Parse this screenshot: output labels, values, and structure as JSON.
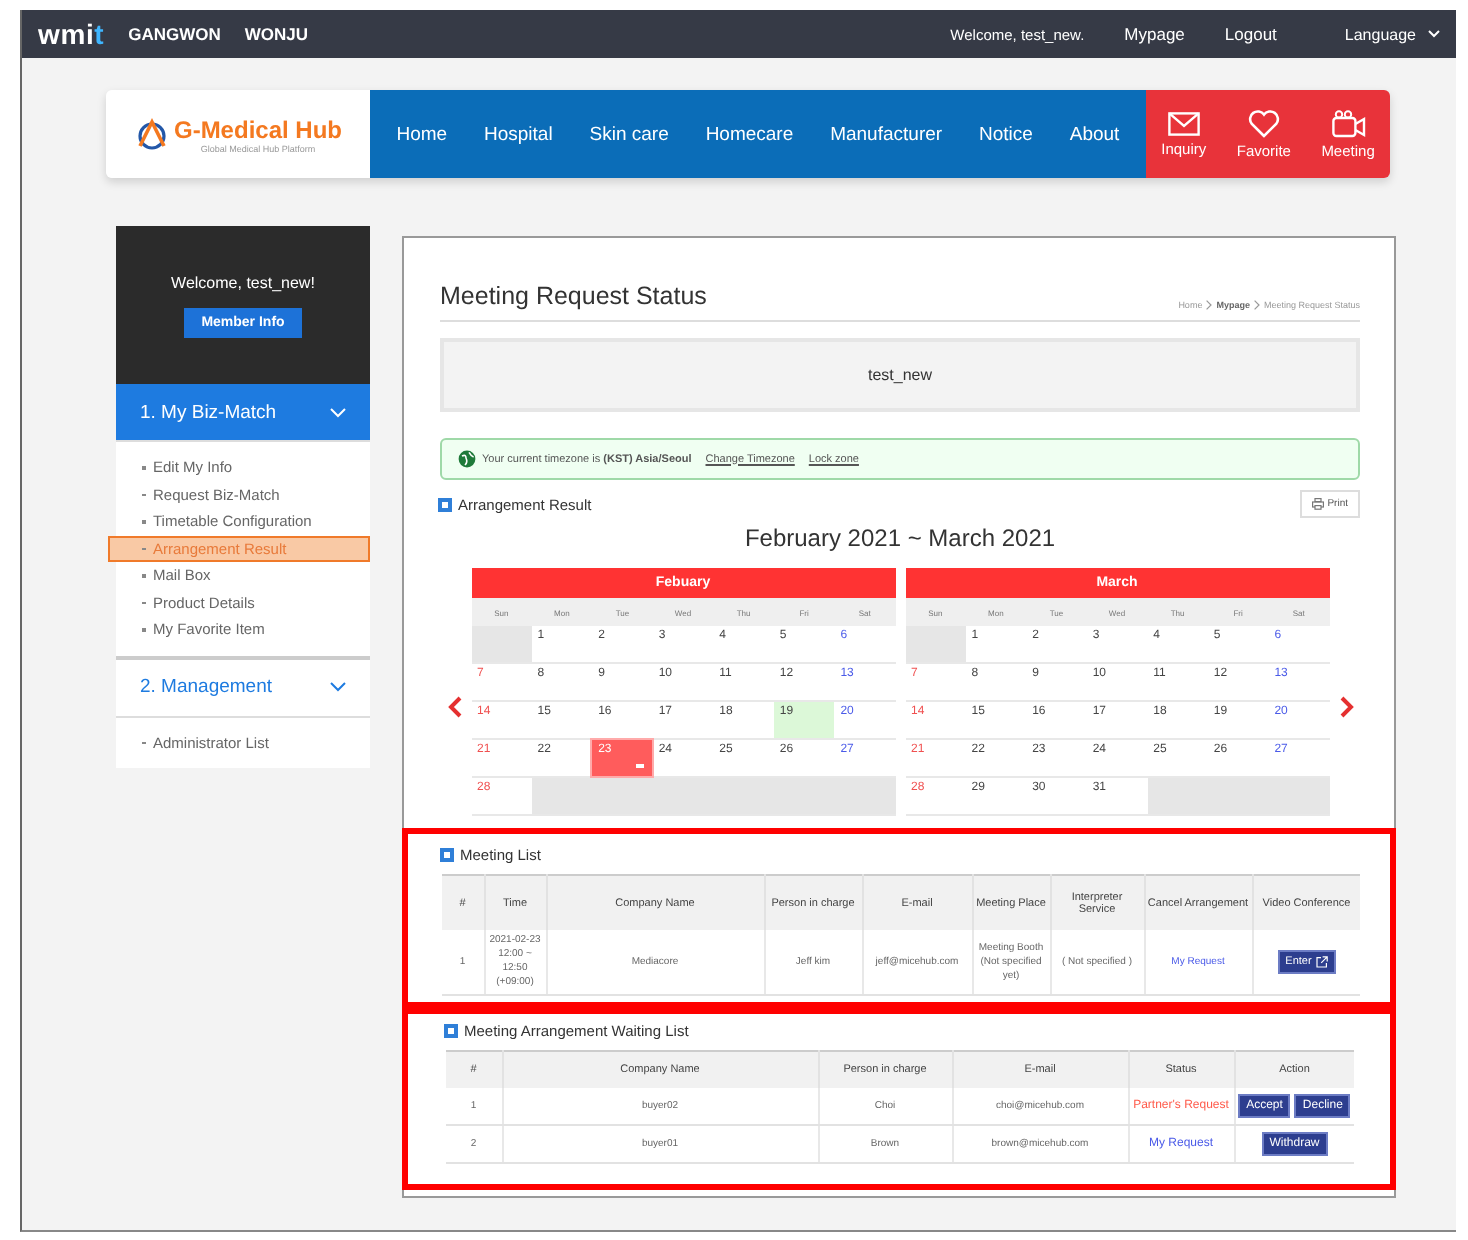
{
  "top_bar": {
    "logo": {
      "text": "wmi",
      "accent": "t"
    },
    "regions": [
      "GANGWON",
      "WONJU"
    ],
    "welcome": "Welcome, test_new.",
    "links": [
      "Mypage",
      "Logout"
    ],
    "language": "Language"
  },
  "header": {
    "brand": "G-Medical Hub",
    "tagline": "Global Medical Hub Platform",
    "nav": [
      "Home",
      "Hospital",
      "Skin care",
      "Homecare",
      "Manufacturer",
      "Notice",
      "About"
    ],
    "quick_links": [
      {
        "label": "Inquiry",
        "kind": "mail"
      },
      {
        "label": "Favorite",
        "kind": "heart"
      },
      {
        "label": "Meeting",
        "kind": "camera"
      }
    ]
  },
  "sidebar": {
    "welcome": "Welcome, test_new!",
    "member_button": "Member Info",
    "sections": [
      {
        "title": "1. My Biz-Match",
        "selected": true,
        "items": [
          {
            "label": "Edit My Info",
            "selected": false
          },
          {
            "label": "Request Biz-Match",
            "selected": false
          },
          {
            "label": "Timetable Configuration",
            "selected": false
          },
          {
            "label": "Arrangement Result",
            "selected": true
          },
          {
            "label": "Mail Box",
            "selected": false
          },
          {
            "label": "Product Details",
            "selected": false
          },
          {
            "label": "My Favorite Item",
            "selected": false
          }
        ]
      },
      {
        "title": "2. Management",
        "selected": false,
        "items": [
          {
            "label": "Administrator List",
            "selected": false
          }
        ]
      }
    ]
  },
  "main": {
    "title": "Meeting Request Status",
    "breadcrumb": [
      {
        "label": "Home",
        "bold": false
      },
      {
        "label": "Mypage",
        "bold": true
      },
      {
        "label": "Meeting Request Status",
        "bold": false
      }
    ],
    "user_box": "test_new",
    "timezone": {
      "text": "Your current timezone is **(KST) Asia/Seoul**",
      "links": [
        "Change Timezone",
        "Lock zone"
      ]
    },
    "arrangement": {
      "title": "Arrangement Result",
      "print_button": "Print",
      "calendar_title": "February 2021 ~ March 2021",
      "months": [
        {
          "name": "Febuary",
          "weekdays": [
            "Sun",
            "Mon",
            "Tue",
            "Wed",
            "Thu",
            "Fri",
            "Sat"
          ],
          "weeks": [
            [
              {
                "kind": "blank"
              },
              {
                "kind": "day",
                "day": "1"
              },
              {
                "kind": "day",
                "day": "2"
              },
              {
                "kind": "day",
                "day": "3"
              },
              {
                "kind": "day",
                "day": "4"
              },
              {
                "kind": "day",
                "day": "5"
              },
              {
                "kind": "day",
                "day": "6"
              }
            ],
            [
              {
                "kind": "day",
                "day": "7"
              },
              {
                "kind": "day",
                "day": "8"
              },
              {
                "kind": "day",
                "day": "9"
              },
              {
                "kind": "day",
                "day": "10"
              },
              {
                "kind": "day",
                "day": "11"
              },
              {
                "kind": "day",
                "day": "12"
              },
              {
                "kind": "day",
                "day": "13"
              }
            ],
            [
              {
                "kind": "day",
                "day": "14"
              },
              {
                "kind": "day",
                "day": "15"
              },
              {
                "kind": "day",
                "day": "16"
              },
              {
                "kind": "day",
                "day": "17"
              },
              {
                "kind": "day",
                "day": "18"
              },
              {
                "kind": "available",
                "day": "19"
              },
              {
                "kind": "day",
                "day": "20"
              }
            ],
            [
              {
                "kind": "day",
                "day": "21"
              },
              {
                "kind": "day",
                "day": "22"
              },
              {
                "kind": "meeting",
                "day": "23"
              },
              {
                "kind": "day",
                "day": "24"
              },
              {
                "kind": "day",
                "day": "25"
              },
              {
                "kind": "day",
                "day": "26"
              },
              {
                "kind": "day",
                "day": "27"
              }
            ],
            [
              {
                "kind": "day",
                "day": "28"
              },
              {
                "kind": "blank"
              },
              {
                "kind": "blank"
              },
              {
                "kind": "blank"
              },
              {
                "kind": "blank"
              },
              {
                "kind": "blank"
              },
              {
                "kind": "blank"
              }
            ]
          ]
        },
        {
          "name": "March",
          "weekdays": [
            "Sun",
            "Mon",
            "Tue",
            "Wed",
            "Thu",
            "Fri",
            "Sat"
          ],
          "weeks": [
            [
              {
                "kind": "blank"
              },
              {
                "kind": "day",
                "day": "1"
              },
              {
                "kind": "day",
                "day": "2"
              },
              {
                "kind": "day",
                "day": "3"
              },
              {
                "kind": "day",
                "day": "4"
              },
              {
                "kind": "day",
                "day": "5"
              },
              {
                "kind": "day",
                "day": "6"
              }
            ],
            [
              {
                "kind": "day",
                "day": "7"
              },
              {
                "kind": "day",
                "day": "8"
              },
              {
                "kind": "day",
                "day": "9"
              },
              {
                "kind": "day",
                "day": "10"
              },
              {
                "kind": "day",
                "day": "11"
              },
              {
                "kind": "day",
                "day": "12"
              },
              {
                "kind": "day",
                "day": "13"
              }
            ],
            [
              {
                "kind": "day",
                "day": "14"
              },
              {
                "kind": "day",
                "day": "15"
              },
              {
                "kind": "day",
                "day": "16"
              },
              {
                "kind": "day",
                "day": "17"
              },
              {
                "kind": "day",
                "day": "18"
              },
              {
                "kind": "day",
                "day": "19"
              },
              {
                "kind": "day",
                "day": "20"
              }
            ],
            [
              {
                "kind": "day",
                "day": "21"
              },
              {
                "kind": "day",
                "day": "22"
              },
              {
                "kind": "day",
                "day": "23"
              },
              {
                "kind": "day",
                "day": "24"
              },
              {
                "kind": "day",
                "day": "25"
              },
              {
                "kind": "day",
                "day": "26"
              },
              {
                "kind": "day",
                "day": "27"
              }
            ],
            [
              {
                "kind": "day",
                "day": "28"
              },
              {
                "kind": "day",
                "day": "29"
              },
              {
                "kind": "day",
                "day": "30"
              },
              {
                "kind": "day",
                "day": "31"
              },
              {
                "kind": "blank"
              },
              {
                "kind": "blank"
              },
              {
                "kind": "blank"
              }
            ]
          ]
        }
      ]
    },
    "meeting_list": {
      "title": "Meeting List",
      "columns": [
        "#",
        "Time",
        "Company Name",
        "Person in charge",
        "E-mail",
        "Meeting Place",
        "Interpreter Service",
        "Cancel Arrangement",
        "Video Conference"
      ],
      "rows": [
        [
          {
            "kind": "text",
            "text": "1"
          },
          {
            "kind": "text",
            "text": "2021-02-23 12:00 ~ 12:50 (+09:00)"
          },
          {
            "kind": "text",
            "text": "Mediacore"
          },
          {
            "kind": "text",
            "text": "Jeff kim"
          },
          {
            "kind": "text",
            "text": "jeff@micehub.com"
          },
          {
            "kind": "text",
            "text": "Meeting Booth (Not specified yet)"
          },
          {
            "kind": "text",
            "text": "( Not specified )"
          },
          {
            "kind": "link",
            "text": "My Request"
          },
          {
            "kind": "button",
            "text": "Enter"
          }
        ]
      ]
    },
    "waiting_list": {
      "title": "Meeting Arrangement Waiting List",
      "columns": [
        "#",
        "Company Name",
        "Person in charge",
        "E-mail",
        "Status",
        "Action"
      ],
      "rows": [
        [
          {
            "kind": "text",
            "text": "1"
          },
          {
            "kind": "text",
            "text": "buyer02"
          },
          {
            "kind": "text",
            "text": "Choi"
          },
          {
            "kind": "text",
            "text": "choi@micehub.com"
          },
          {
            "kind": "status",
            "text": "Partner's Request",
            "color": "#ff5a4a"
          },
          {
            "kind": "buttons",
            "buttons": [
              "Accept",
              "Decline"
            ]
          }
        ],
        [
          {
            "kind": "text",
            "text": "2"
          },
          {
            "kind": "text",
            "text": "buyer01"
          },
          {
            "kind": "text",
            "text": "Brown"
          },
          {
            "kind": "text",
            "text": "brown@micehub.com"
          },
          {
            "kind": "status",
            "text": "My Request",
            "color": "#4a5ae8"
          },
          {
            "kind": "buttons",
            "buttons": [
              "Withdraw"
            ]
          }
        ]
      ]
    }
  }
}
